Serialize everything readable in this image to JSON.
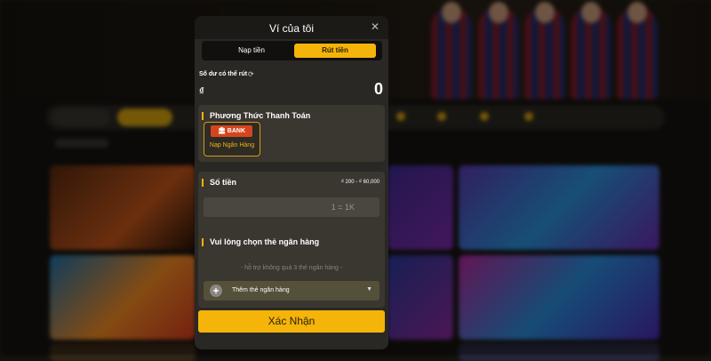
{
  "modal": {
    "title": "Ví của tôi",
    "close_icon": "close-icon"
  },
  "tabs": [
    {
      "label": "Nạp tiền",
      "active": false
    },
    {
      "label": "Rút tiền",
      "active": true
    }
  ],
  "balance": {
    "label": "Số dư có thể rút",
    "currency": "₫",
    "value": "0"
  },
  "payment_method": {
    "title": "Phương Thức Thanh Toán",
    "bank_logo_text": "BANK",
    "option_label": "Nạp Ngân Hàng"
  },
  "amount": {
    "title": "Số tiền",
    "range": "₫ 200 - ₫ 60,000",
    "placeholder": "1 = 1K"
  },
  "bank_cards": {
    "title": "Vui lòng chọn thẻ ngân hàng",
    "hint": "- hỗ trợ không quá 3 thẻ ngân hàng -",
    "add_label": "Thêm thẻ ngân hàng"
  },
  "confirm_button": "Xác Nhận",
  "colors": {
    "accent": "#f5b40a",
    "modal_bg": "#2a2824",
    "section_bg": "#3a3630",
    "bank_red": "#d4451e"
  }
}
